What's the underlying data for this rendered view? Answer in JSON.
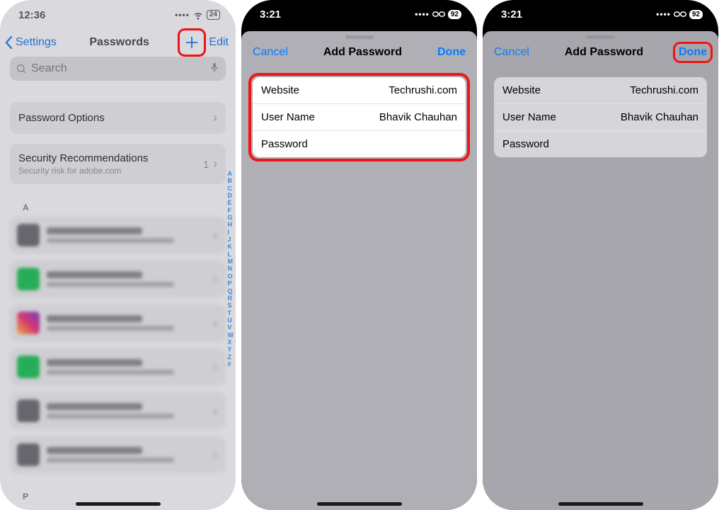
{
  "screen1": {
    "status_time": "12:36",
    "battery": "24",
    "back_label": "Settings",
    "title": "Passwords",
    "edit_label": "Edit",
    "search_placeholder": "Search",
    "password_options": "Password Options",
    "sec_rec_title": "Security Recommendations",
    "sec_rec_sub": "Security risk for adobe.com",
    "sec_rec_count": "1",
    "letter_a": "A",
    "letter_p": "P",
    "index_letters": "ABCDEFGHIJKLMNOPQRSTUVWXYZ#"
  },
  "screen2": {
    "status_time": "3:21",
    "battery": "92",
    "cancel": "Cancel",
    "title": "Add Password",
    "done": "Done",
    "website_label": "Website",
    "website_value": "Techrushi.com",
    "username_label": "User Name",
    "username_value": "Bhavik Chauhan",
    "password_label": "Password"
  },
  "screen3": {
    "status_time": "3:21",
    "battery": "92",
    "cancel": "Cancel",
    "title": "Add Password",
    "done": "Done",
    "website_label": "Website",
    "website_value": "Techrushi.com",
    "username_label": "User Name",
    "username_value": "Bhavik Chauhan",
    "password_label": "Password"
  }
}
